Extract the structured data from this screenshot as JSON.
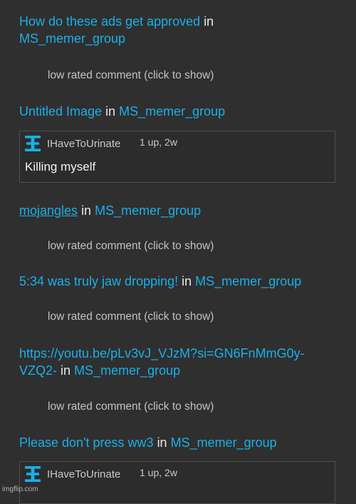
{
  "in_word": "in",
  "group": "MS_memer_group",
  "low_rated": "low rated comment (click to show)",
  "entries": [
    {
      "title_1": "How do these ads get approved",
      "group": "MS_memer_group"
    },
    {
      "title": "Untitled Image",
      "group": "MS_memer_group"
    },
    {
      "title": "mojangles",
      "group": "MS_memer_group"
    },
    {
      "title": "5:34 was truly jaw dropping!",
      "group": "MS_memer_group"
    },
    {
      "title_1": "https://youtu.be/pLv3vJ_VJzM?si=GN6FnMmG0y-",
      "title_2": "VZQ2-",
      "group": "MS_memer_group"
    },
    {
      "title": "Please don't press ww3",
      "group": "MS_memer_group"
    }
  ],
  "comments": [
    {
      "user": "IHaveToUrinate",
      "meta": "1 up, 2w",
      "text": "Killing myself",
      "avatar_icon": "user-avatar-icon"
    },
    {
      "user": "IHaveToUrinate",
      "meta": "1 up, 2w",
      "text": "",
      "avatar_icon": "user-avatar-icon"
    }
  ],
  "watermark": "imgflip.com",
  "colors": {
    "link": "#1ab0e6",
    "background": "#2f2f30",
    "avatar": "#1ab0e6"
  }
}
